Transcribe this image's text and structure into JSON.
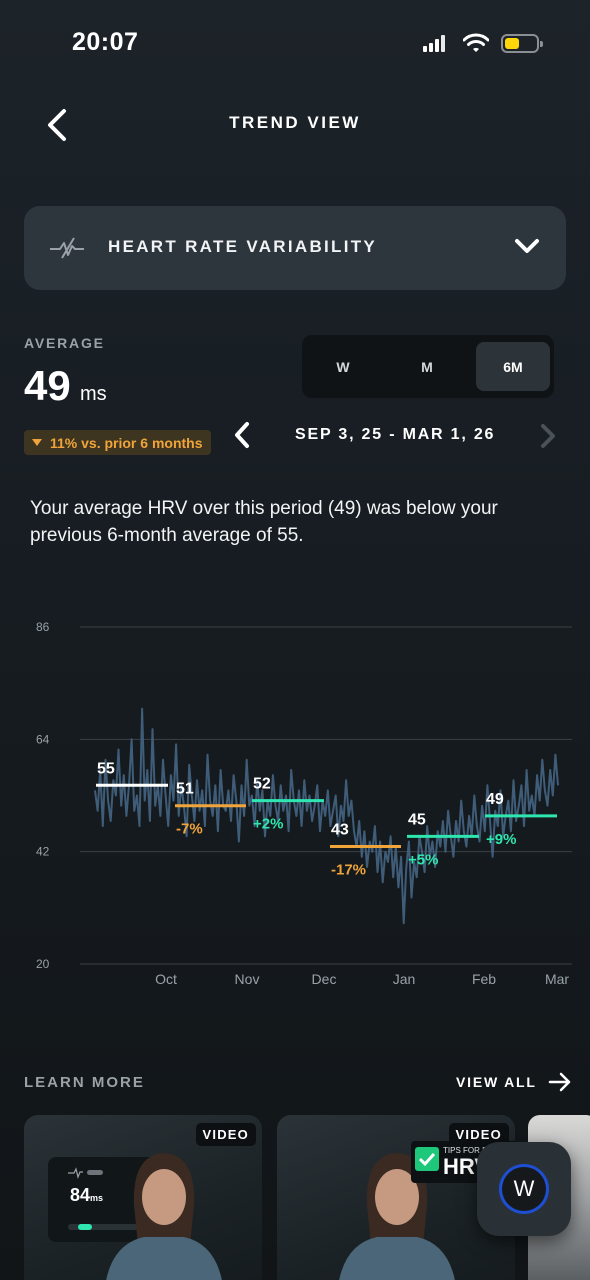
{
  "status_bar": {
    "time": "20:07"
  },
  "header": {
    "title": "TREND VIEW",
    "back_icon": "chevron-left-icon"
  },
  "metric_selector": {
    "label": "HEART RATE VARIABILITY",
    "icon": "hrv-icon",
    "chevron": "chevron-down-icon"
  },
  "summary": {
    "average_label": "AVERAGE",
    "average_value": "49",
    "average_unit": "ms",
    "change_badge": "11% vs. prior 6 months",
    "badge_color": "#f0a43a",
    "description": "Your average HRV over this period (49) was below your previous 6-month average of 55."
  },
  "period_tabs": [
    {
      "label": "W",
      "active": false
    },
    {
      "label": "M",
      "active": false
    },
    {
      "label": "6M",
      "active": true
    }
  ],
  "date_range": {
    "label": "SEP 3, 25 - MAR 1, 26"
  },
  "chart_data": {
    "type": "line",
    "y_ticks": [
      "86",
      "64",
      "42",
      "20"
    ],
    "ylim": [
      20,
      86
    ],
    "x_ticks": [
      "Oct",
      "Nov",
      "Dec",
      "Jan",
      "Feb",
      "Mar"
    ],
    "grid": true,
    "monthly_averages": [
      {
        "value": 55,
        "label": "55",
        "change": "",
        "color": "#ffffff"
      },
      {
        "value": 51,
        "label": "51",
        "change": "-7%",
        "color": "#f0a43a"
      },
      {
        "value": 52,
        "label": "52",
        "change": "+2%",
        "color": "#2ee6b0"
      },
      {
        "value": 43,
        "label": "43",
        "change": "-17%",
        "color": "#f0a43a"
      },
      {
        "value": 45,
        "label": "45",
        "change": "+5%",
        "color": "#2ee6b0"
      },
      {
        "value": 49,
        "label": "49",
        "change": "+9%",
        "color": "#2ee6b0"
      }
    ],
    "series": [
      {
        "values": [
          54,
          50,
          58,
          47,
          60,
          52,
          48,
          56,
          53,
          62,
          51,
          57,
          49,
          55,
          64,
          50,
          53,
          47,
          70,
          52,
          58,
          48,
          66,
          51,
          55,
          49,
          60,
          53,
          47,
          57,
          52,
          63,
          49,
          55,
          51,
          45,
          59,
          53,
          48,
          56,
          50,
          54,
          47,
          61,
          52,
          49,
          55,
          46,
          58,
          51,
          50,
          54,
          48,
          57,
          52,
          44,
          55,
          49,
          60,
          51,
          53,
          47,
          56,
          50,
          54,
          45,
          52,
          49,
          57,
          51,
          48,
          55,
          50,
          53,
          46,
          58,
          52,
          49,
          54,
          47,
          56,
          50,
          53,
          48,
          51,
          55,
          46,
          52,
          49,
          54,
          47,
          50,
          53,
          45,
          51,
          48,
          56,
          49,
          52,
          46,
          43,
          48,
          41,
          46,
          39,
          44,
          42,
          47,
          38,
          44,
          36,
          42,
          40,
          45,
          37,
          43,
          35,
          41,
          28,
          39,
          44,
          33,
          40,
          37,
          45,
          42,
          38,
          47,
          41,
          44,
          39,
          46,
          43,
          48,
          42,
          50,
          45,
          41,
          48,
          44,
          52,
          46,
          43,
          49,
          45,
          53,
          47,
          44,
          51,
          46,
          55,
          48,
          41,
          50,
          47,
          54,
          45,
          49,
          52,
          46,
          56,
          48,
          51,
          55,
          47,
          58,
          50,
          53,
          49,
          57,
          52,
          60,
          54,
          51,
          58,
          53,
          61,
          55
        ]
      }
    ]
  },
  "learn_more": {
    "label": "LEARN MORE",
    "view_all": "VIEW ALL",
    "cards": [
      {
        "badge": "VIDEO",
        "metric_value": "84",
        "metric_unit": "ms"
      },
      {
        "badge": "VIDEO",
        "tips_top": "TIPS FOR B",
        "tips_main": "HRV"
      }
    ]
  }
}
